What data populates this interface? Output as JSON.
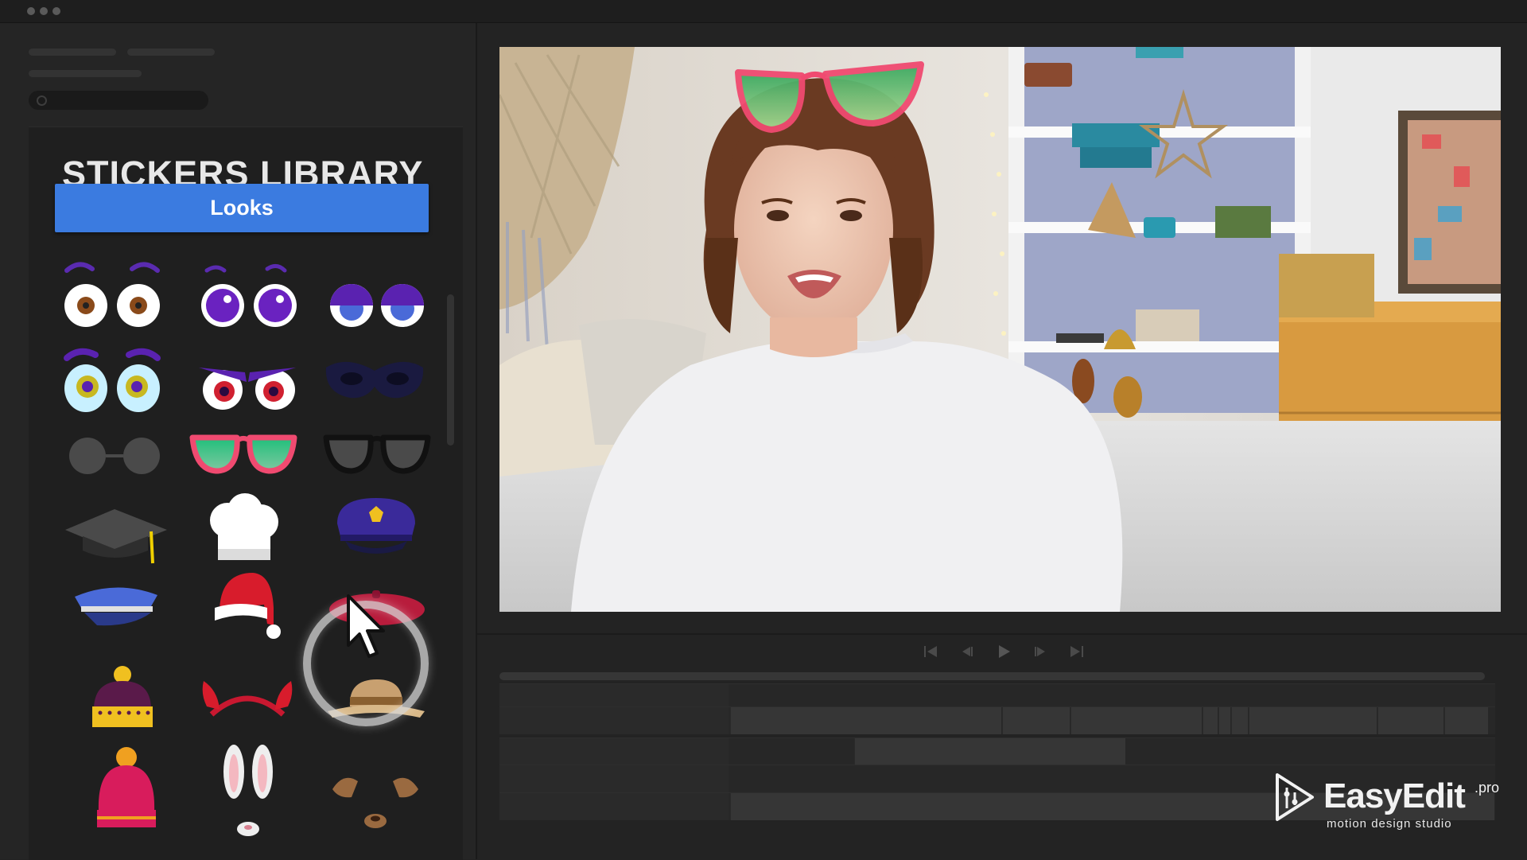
{
  "library": {
    "title": "STICKERS LIBRARY",
    "category_button": "Looks",
    "stickers": [
      "brown-eyes-icon",
      "purple-eyes-icon",
      "sleepy-eyes-icon",
      "crying-eyes-icon",
      "angry-eyes-icon",
      "masquerade-mask-icon",
      "round-glasses-icon",
      "pink-sunglasses-icon",
      "black-sunglasses-icon",
      "graduation-cap-icon",
      "chef-hat-icon",
      "police-hat-icon",
      "captain-cap-icon",
      "santa-hat-icon",
      "red-beret-icon",
      "beanie-icon",
      "devil-horns-icon",
      "straw-hat-icon",
      "pom-pom-hat-icon",
      "bunny-ears-icon",
      "dog-ears-icon"
    ]
  },
  "preview": {
    "overlay_sticker": "pink-sunglasses-icon"
  },
  "logo": {
    "name": "EasyEdit",
    "suffix": ".pro",
    "tagline": "motion design studio"
  },
  "colors": {
    "accent": "#3b7be0",
    "panel": "#1f1f1f",
    "background": "#232323"
  }
}
